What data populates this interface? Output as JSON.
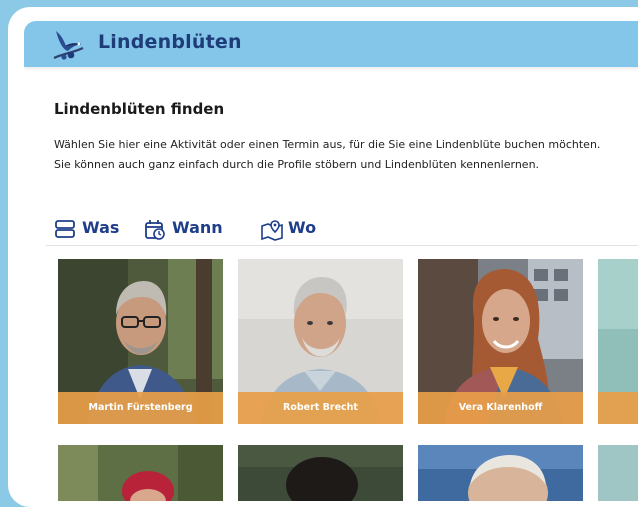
{
  "header": {
    "brand": "Lindenblüten",
    "logo_icon": "bird-on-branch-icon"
  },
  "main": {
    "title": "Lindenblüten finden",
    "intro_line1": "Wählen Sie hier eine Aktivität oder einen Termin aus, für die Sie eine Lindenblüte buchen möchten.",
    "intro_line2": "Sie können auch ganz einfach durch die Profile stöbern und Lindenblüten kennenlernen."
  },
  "filters": [
    {
      "label": "Was",
      "icon": "activities-icon"
    },
    {
      "label": "Wann",
      "icon": "calendar-clock-icon"
    },
    {
      "label": "Wo",
      "icon": "map-pin-icon"
    }
  ],
  "profiles": [
    {
      "name": "Martin Fürstenberg"
    },
    {
      "name": "Robert Brecht"
    },
    {
      "name": "Vera Klarenhoff"
    },
    {
      "name": ""
    }
  ],
  "colors": {
    "accent": "#1f3e8a",
    "header_bg": "#84c5ea",
    "name_bar": "#e89e48",
    "page_bg": "#8cc9e6"
  }
}
